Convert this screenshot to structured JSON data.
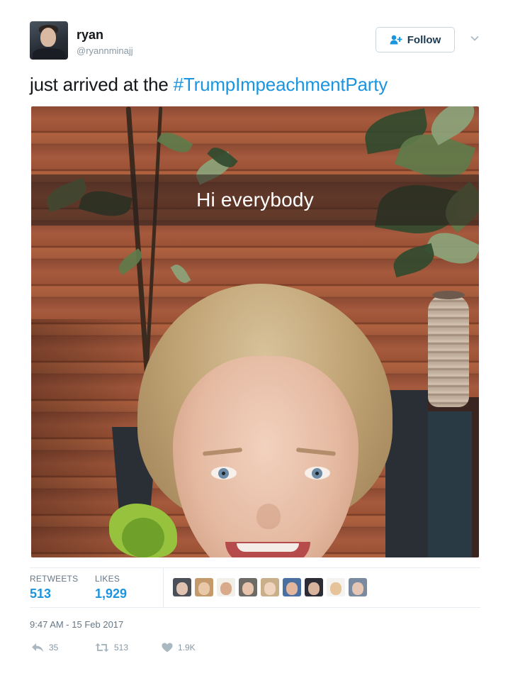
{
  "user": {
    "name": "ryan",
    "handle": "@ryannminajj"
  },
  "follow_button": {
    "label": "Follow",
    "icon": "add-user-icon"
  },
  "menu_icon": "chevron-down-icon",
  "tweet": {
    "text_plain": "just arrived at the ",
    "hashtag": "#TrumpImpeachmentParty"
  },
  "media": {
    "overlay_text": "Hi everybody"
  },
  "stats": {
    "retweets_label": "RETWEETS",
    "retweets_value": "513",
    "likes_label": "LIKES",
    "likes_value": "1,929"
  },
  "likers": [
    {
      "bg": "#4b4f57",
      "face": "#e0c2b0"
    },
    {
      "bg": "#c49a6c",
      "face": "#e8c8a8"
    },
    {
      "bg": "#f2efe9",
      "face": "#d9a98c"
    },
    {
      "bg": "#6e6a66",
      "face": "#e6c3aa"
    },
    {
      "bg": "#c9b08a",
      "face": "#f0d4bd"
    },
    {
      "bg": "#4a6fa1",
      "face": "#e2b79d"
    },
    {
      "bg": "#2c2c36",
      "face": "#d8b49c"
    },
    {
      "bg": "#f5f3ef",
      "face": "#e7c39a"
    },
    {
      "bg": "#7a8aa0",
      "face": "#e5c5b3"
    }
  ],
  "timestamp": "9:47 AM - 15 Feb 2017",
  "actions": {
    "reply_count": "35",
    "retweet_count": "513",
    "like_count": "1.9K"
  },
  "colors": {
    "accent": "#1b95e0",
    "muted": "#8899a6",
    "text": "#14171a"
  }
}
